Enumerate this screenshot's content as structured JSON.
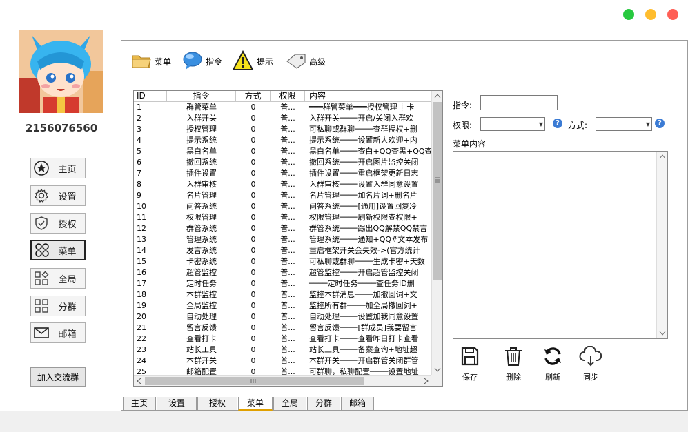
{
  "window": {
    "dots": [
      "#27c93f",
      "#ffbd2e",
      "#ff5f56"
    ]
  },
  "user": {
    "id": "2156076560"
  },
  "nav": [
    {
      "key": "home",
      "label": "主页",
      "icon": "star-icon"
    },
    {
      "key": "settings",
      "label": "设置",
      "icon": "gear-icon"
    },
    {
      "key": "auth",
      "label": "授权",
      "icon": "shield-icon"
    },
    {
      "key": "menu",
      "label": "菜单",
      "icon": "menu-grid-icon"
    },
    {
      "key": "global",
      "label": "全局",
      "icon": "apps-icon"
    },
    {
      "key": "group",
      "label": "分群",
      "icon": "grid-icon"
    },
    {
      "key": "mail",
      "label": "邮箱",
      "icon": "envelope-icon"
    }
  ],
  "join_button": "加入交流群",
  "toolbar": [
    {
      "label": "菜单",
      "icon": "folder-icon"
    },
    {
      "label": "指令",
      "icon": "chat-bubble-icon"
    },
    {
      "label": "提示",
      "icon": "warning-icon"
    },
    {
      "label": "高级",
      "icon": "tag-icon"
    }
  ],
  "table": {
    "headers": [
      "ID",
      "指令",
      "方式",
      "权限",
      "内容"
    ],
    "rows": [
      [
        "1",
        "群管菜单",
        "0",
        "普...",
        "═══群管菜单═══授权管理 ┊ 卡"
      ],
      [
        "2",
        "入群开关",
        "0",
        "普...",
        "入群开关────开启/关闭入群欢"
      ],
      [
        "3",
        "授权管理",
        "0",
        "普...",
        "可私聊或群聊────查群授权+删"
      ],
      [
        "4",
        "提示系统",
        "0",
        "普...",
        "提示系统────设置新人欢迎+内"
      ],
      [
        "5",
        "黑白名单",
        "0",
        "普...",
        "黑白名单────查白+QQ查黑+QQ查"
      ],
      [
        "6",
        "撤回系统",
        "0",
        "普...",
        "撤回系统────开启图片监控关闭"
      ],
      [
        "7",
        "插件设置",
        "0",
        "普...",
        "插件设置────重启框架更新日志"
      ],
      [
        "8",
        "入群审核",
        "0",
        "普...",
        "入群审核────设置入群同意设置"
      ],
      [
        "9",
        "名片管理",
        "0",
        "普...",
        "名片管理────加名片词+删名片"
      ],
      [
        "10",
        "问答系统",
        "0",
        "普...",
        "问答系统────[通用]设置回复冷"
      ],
      [
        "11",
        "权限管理",
        "0",
        "普...",
        "权限管理────刷新权限查权限+"
      ],
      [
        "12",
        "群管系统",
        "0",
        "普...",
        "群管系统────踢出QQ解禁QQ禁言"
      ],
      [
        "13",
        "管理系统",
        "0",
        "普...",
        "管理系统────通知+QQ#文本发布"
      ],
      [
        "14",
        "发言系统",
        "0",
        "普...",
        "重启框架开关会失效->(官方统计"
      ],
      [
        "15",
        "卡密系统",
        "0",
        "普...",
        "可私聊或群聊────生成卡密+天数"
      ],
      [
        "16",
        "超管监控",
        "0",
        "普...",
        "超管监控────开启超管监控关闭"
      ],
      [
        "17",
        "定时任务",
        "0",
        "普...",
        "────定时任务────查任务ID删"
      ],
      [
        "18",
        "本群监控",
        "0",
        "普...",
        "监控本群消息────加撤回词+文"
      ],
      [
        "19",
        "全局监控",
        "0",
        "普...",
        "监控所有群────加全局撤回词+"
      ],
      [
        "20",
        "自动处理",
        "0",
        "普...",
        "自动处理────设置加我同意设置"
      ],
      [
        "21",
        "留言反馈",
        "0",
        "普...",
        "留言反馈────[群成员]我要留言"
      ],
      [
        "22",
        "查看打卡",
        "0",
        "普...",
        "查看打卡────查看昨日打卡查看"
      ],
      [
        "23",
        "站长工具",
        "0",
        "普...",
        "站长工具────备案查询+地址超"
      ],
      [
        "24",
        "本群开关",
        "0",
        "普...",
        "本群开关────开启群管关闭群管"
      ],
      [
        "25",
        "邮箱配置",
        "0",
        "普...",
        "可群聊，私聊配置────设置地址"
      ]
    ]
  },
  "form": {
    "command_label": "指令:",
    "permission_label": "权限:",
    "mode_label": "方式:",
    "content_label": "菜单内容"
  },
  "actions": [
    {
      "label": "保存",
      "icon": "save-icon"
    },
    {
      "label": "删除",
      "icon": "trash-icon"
    },
    {
      "label": "刷新",
      "icon": "refresh-icon"
    },
    {
      "label": "同步",
      "icon": "cloud-sync-icon"
    }
  ],
  "tabs": [
    "主页",
    "设置",
    "授权",
    "菜单",
    "全局",
    "分群",
    "邮箱"
  ],
  "selected_tab": "菜单"
}
